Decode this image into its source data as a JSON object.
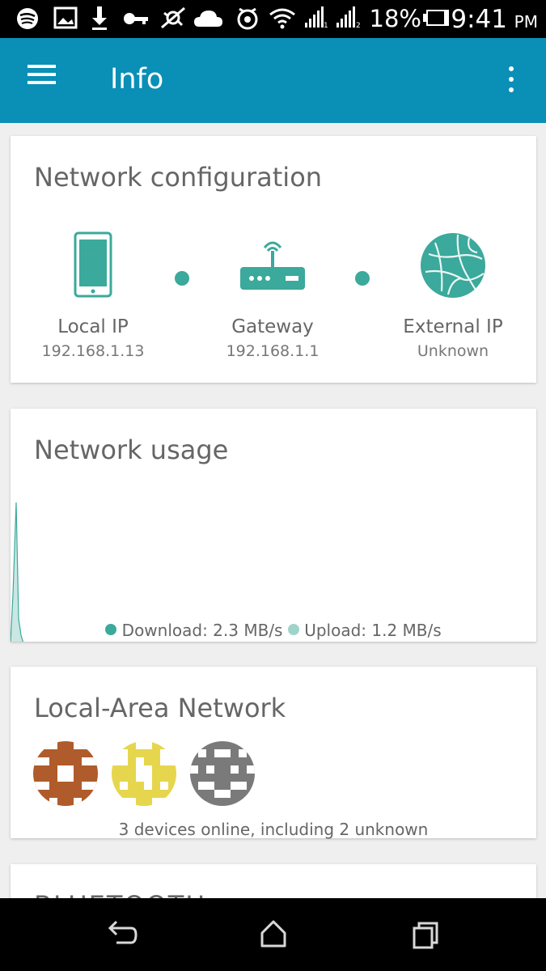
{
  "status_bar": {
    "icons": [
      "spotify-icon",
      "image-icon",
      "download-icon",
      "key-icon",
      "satellite-icon",
      "cloud-icon",
      "alarm-icon",
      "wifi-icon",
      "signal-1-icon",
      "signal-2-icon",
      "battery-icon"
    ],
    "battery": "18%",
    "time": "9:41",
    "ampm": "PM"
  },
  "app_bar": {
    "title": "Info",
    "color": "#0a8fb7",
    "left_icon": "menu-icon",
    "right_icon": "more-vert-icon"
  },
  "network_config": {
    "title": "Network configuration",
    "accent": "#3ba99b",
    "nodes": [
      {
        "label": "Local IP",
        "value": "192.168.1.13",
        "icon": "smartphone-icon"
      },
      {
        "label": "Gateway",
        "value": "192.168.1.1",
        "icon": "router-icon"
      },
      {
        "label": "External IP",
        "value": "Unknown",
        "icon": "globe-icon"
      }
    ]
  },
  "network_usage": {
    "title": "Network usage",
    "download": "Download: 2.3 MB/s",
    "upload": "Upload: 1.2 MB/s",
    "download_color": "#3ba99b",
    "upload_color": "#9fd4cc"
  },
  "lan": {
    "title": "Local-Area Network",
    "status": "3 devices online, including 2 unknown",
    "avatar_colors": [
      "#b05b2b",
      "#e6d64d",
      "#7a7a7a"
    ]
  },
  "partial_card": {
    "title": "BLUETOOTH"
  },
  "nav_bar": {
    "icons": [
      "back-icon",
      "home-icon",
      "recents-icon"
    ]
  }
}
